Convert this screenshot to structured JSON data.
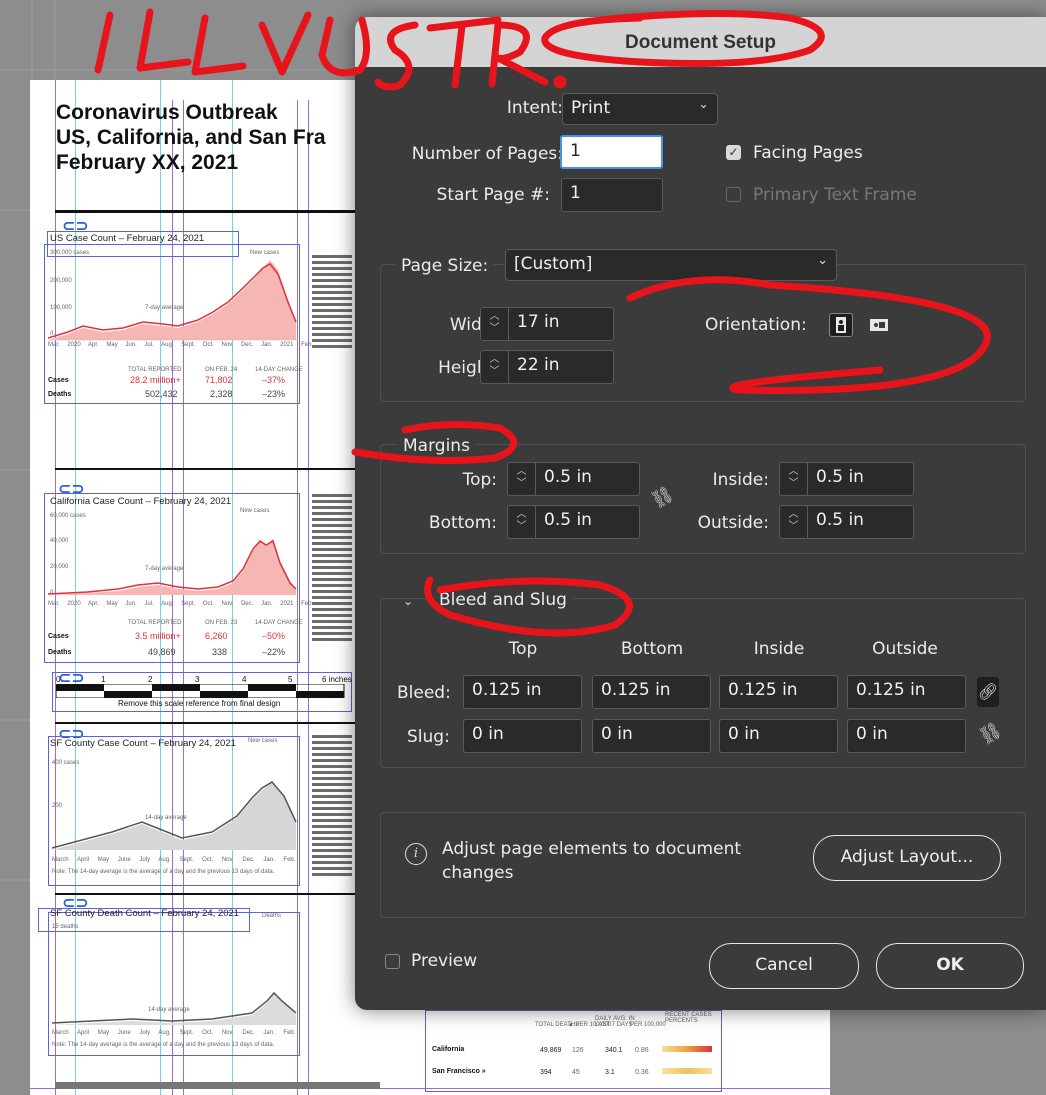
{
  "background_document": {
    "title_lines": [
      "Coronavirus Outbreak",
      "US, California, and San Fra",
      "February XX, 2021"
    ],
    "charts": [
      {
        "title": "US Case Count – February 24, 2021",
        "y_top_label": "300,000 cases",
        "y_labels": [
          "200,000",
          "100,000",
          "0"
        ],
        "avg_label": "7-day average",
        "new_label": "New cases",
        "x_labels": [
          "Mar. 2020",
          "Apr.",
          "May",
          "Jun.",
          "Jul.",
          "Aug.",
          "Sept.",
          "Oct.",
          "Nov.",
          "Dec.",
          "Jan. 2021",
          "Feb."
        ],
        "table_headers": [
          "TOTAL REPORTED",
          "ON FEB. 24",
          "14-DAY CHANGE"
        ],
        "rows": [
          {
            "label": "Cases",
            "total": "28.2 million+",
            "on_day": "71,802",
            "change": "–37%"
          },
          {
            "label": "Deaths",
            "total": "502,432",
            "on_day": "2,328",
            "change": "–23%"
          }
        ]
      },
      {
        "title": "California Case Count – February 24, 2021",
        "y_top_label": "60,000 cases",
        "y_labels": [
          "40,000",
          "20,000",
          "0"
        ],
        "avg_label": "7-day average",
        "new_label": "New cases",
        "x_labels": [
          "Mar. 2020",
          "Apr.",
          "May",
          "Jun.",
          "Jul.",
          "Aug.",
          "Sept.",
          "Oct.",
          "Nov.",
          "Dec.",
          "Jan. 2021",
          "Feb."
        ],
        "table_headers": [
          "TOTAL REPORTED",
          "ON FEB. 23",
          "14-DAY CHANGE"
        ],
        "rows": [
          {
            "label": "Cases",
            "total": "3.5 million+",
            "on_day": "6,260",
            "change": "–50%"
          },
          {
            "label": "Deaths",
            "total": "49,869",
            "on_day": "338",
            "change": "–22%"
          }
        ]
      },
      {
        "title": "SF County Case Count – February 24, 2021",
        "y_top_label": "400 cases",
        "y_labels": [
          "200"
        ],
        "avg_label": "14-day average",
        "new_label": "New cases",
        "x_labels": [
          "March",
          "April",
          "May",
          "June",
          "July",
          "Aug.",
          "Sept.",
          "Oct.",
          "Nov.",
          "Dec.",
          "Jan.",
          "Feb."
        ],
        "note": "Note: The 14-day average is the average of a day and the previous 13 days of data."
      },
      {
        "title": "SF County Death Count – February 24, 2021",
        "y_top_label": "15 deaths",
        "avg_label": "14-day average",
        "new_label": "Deaths",
        "x_labels": [
          "March",
          "April",
          "May",
          "June",
          "July",
          "Aug.",
          "Sept.",
          "Oct.",
          "Nov.",
          "Dec.",
          "Jan.",
          "Feb."
        ],
        "note": "Note: The 14-day average is the average of a day and the previous 13 days of data."
      }
    ],
    "scale_bar": {
      "ticks": [
        "0",
        "1",
        "2",
        "3",
        "4",
        "5",
        "6 inches"
      ],
      "caption": "Remove this scale reference from final design"
    },
    "bottom_table": {
      "headers": [
        "TOTAL DEATHS",
        "▲ PER 100,000",
        "DAILY AVG. IN LAST 7 DAYS",
        "PER 100,000",
        "RECENT CASES PERCENTS"
      ],
      "rows": [
        {
          "name": "California",
          "values": [
            "49,869",
            "126",
            "340.1",
            "0.86"
          ]
        },
        {
          "name": "San Francisco »",
          "values": [
            "394",
            "45",
            "3.1",
            "0.36"
          ]
        }
      ]
    }
  },
  "annotations": {
    "handwritten": "ILLUSTR.",
    "color": "#e8141c"
  },
  "dialog": {
    "title": "Document Setup",
    "intent": {
      "label": "Intent:",
      "value": "Print"
    },
    "num_pages": {
      "label": "Number of Pages:",
      "value": "1"
    },
    "facing_pages": {
      "label": "Facing Pages",
      "checked": true
    },
    "start_page": {
      "label": "Start Page #:",
      "value": "1"
    },
    "primary_text_frame": {
      "label": "Primary Text Frame",
      "checked": false,
      "disabled": true
    },
    "page_size": {
      "label": "Page Size:",
      "value": "[Custom]"
    },
    "width": {
      "label": "Width:",
      "value": "17 in"
    },
    "height": {
      "label": "Height:",
      "value": "22 in"
    },
    "orientation": {
      "label": "Orientation:",
      "selected": "portrait"
    },
    "margins": {
      "label": "Margins",
      "top": {
        "label": "Top:",
        "value": "0.5 in"
      },
      "bottom": {
        "label": "Bottom:",
        "value": "0.5 in"
      },
      "inside": {
        "label": "Inside:",
        "value": "0.5 in"
      },
      "outside": {
        "label": "Outside:",
        "value": "0.5 in"
      }
    },
    "bleed_slug": {
      "label": "Bleed and Slug",
      "columns": [
        "Top",
        "Bottom",
        "Inside",
        "Outside"
      ],
      "bleed": {
        "label": "Bleed:",
        "values": [
          "0.125 in",
          "0.125 in",
          "0.125 in",
          "0.125 in"
        ]
      },
      "slug": {
        "label": "Slug:",
        "values": [
          "0 in",
          "0 in",
          "0 in",
          "0 in"
        ]
      }
    },
    "adjust": {
      "text_line1": "Adjust page elements to document",
      "text_line2": "changes",
      "button": "Adjust Layout..."
    },
    "preview": {
      "label": "Preview",
      "checked": false
    },
    "cancel": "Cancel",
    "ok": "OK"
  }
}
